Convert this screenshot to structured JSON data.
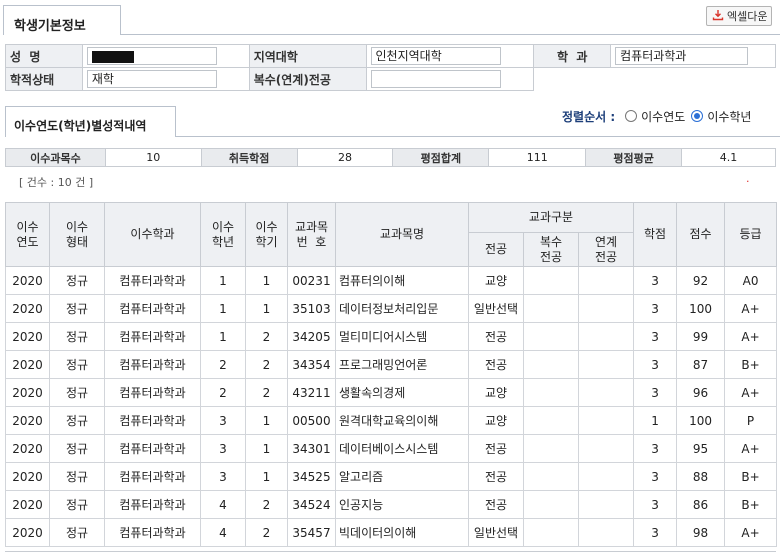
{
  "tabs": {
    "basic_info": "학생기본정보",
    "grades": "이수연도(학년)별성적내역"
  },
  "excel_button": {
    "label": "엑셀다운",
    "icon": "download-icon",
    "icon_color": "#d9342b"
  },
  "info": {
    "name_label": "성  명",
    "name_value": "",
    "region_label": "지역대학",
    "region_value": "인천지역대학",
    "dept_label": "학  과",
    "dept_value": "컴퓨터과학과",
    "status_label": "학적상태",
    "status_value": "재학",
    "double_major_label": "복수(연계)전공",
    "double_major_value": ""
  },
  "sort": {
    "label": "정렬순서 :",
    "options": [
      {
        "label": "이수연도",
        "selected": false
      },
      {
        "label": "이수학년",
        "selected": true
      }
    ]
  },
  "summary": {
    "course_count_label": "이수과목수",
    "course_count": "10",
    "credits_label": "취득학점",
    "credits": "28",
    "grade_sum_label": "평점합계",
    "grade_sum": "111",
    "grade_avg_label": "평점평균",
    "grade_avg": "4.1"
  },
  "count_text": "[ 건수 : 10 건 ]",
  "red_dot": "·",
  "table": {
    "headers": {
      "year": "이수\n연도",
      "type": "이수\n형태",
      "dept": "이수학과",
      "grade_year": "이수\n학년",
      "semester": "이수\n학기",
      "code": "교과목\n번  호",
      "course": "교과목명",
      "category": "교과구분",
      "major": "전공",
      "double": "복수\n전공",
      "linked": "연계\n전공",
      "credit": "학점",
      "score": "점수",
      "letter": "등급"
    },
    "rows": [
      [
        "2020",
        "정규",
        "컴퓨터과학과",
        "1",
        "1",
        "00231",
        "컴퓨터의이해",
        "교양",
        "",
        "",
        "3",
        "92",
        "A0"
      ],
      [
        "2020",
        "정규",
        "컴퓨터과학과",
        "1",
        "1",
        "35103",
        "데이터정보처리입문",
        "일반선택",
        "",
        "",
        "3",
        "100",
        "A+"
      ],
      [
        "2020",
        "정규",
        "컴퓨터과학과",
        "1",
        "2",
        "34205",
        "멀티미디어시스템",
        "전공",
        "",
        "",
        "3",
        "99",
        "A+"
      ],
      [
        "2020",
        "정규",
        "컴퓨터과학과",
        "2",
        "2",
        "34354",
        "프로그래밍언어론",
        "전공",
        "",
        "",
        "3",
        "87",
        "B+"
      ],
      [
        "2020",
        "정규",
        "컴퓨터과학과",
        "2",
        "2",
        "43211",
        "생활속의경제",
        "교양",
        "",
        "",
        "3",
        "96",
        "A+"
      ],
      [
        "2020",
        "정규",
        "컴퓨터과학과",
        "3",
        "1",
        "00500",
        "원격대학교육의이해",
        "교양",
        "",
        "",
        "1",
        "100",
        "P"
      ],
      [
        "2020",
        "정규",
        "컴퓨터과학과",
        "3",
        "1",
        "34301",
        "데이터베이스시스템",
        "전공",
        "",
        "",
        "3",
        "95",
        "A+"
      ],
      [
        "2020",
        "정규",
        "컴퓨터과학과",
        "3",
        "1",
        "34525",
        "알고리즘",
        "전공",
        "",
        "",
        "3",
        "88",
        "B+"
      ],
      [
        "2020",
        "정규",
        "컴퓨터과학과",
        "4",
        "2",
        "34524",
        "인공지능",
        "전공",
        "",
        "",
        "3",
        "86",
        "B+"
      ],
      [
        "2020",
        "정규",
        "컴퓨터과학과",
        "4",
        "2",
        "35457",
        "빅데이터의이해",
        "일반선택",
        "",
        "",
        "3",
        "98",
        "A+"
      ]
    ]
  }
}
